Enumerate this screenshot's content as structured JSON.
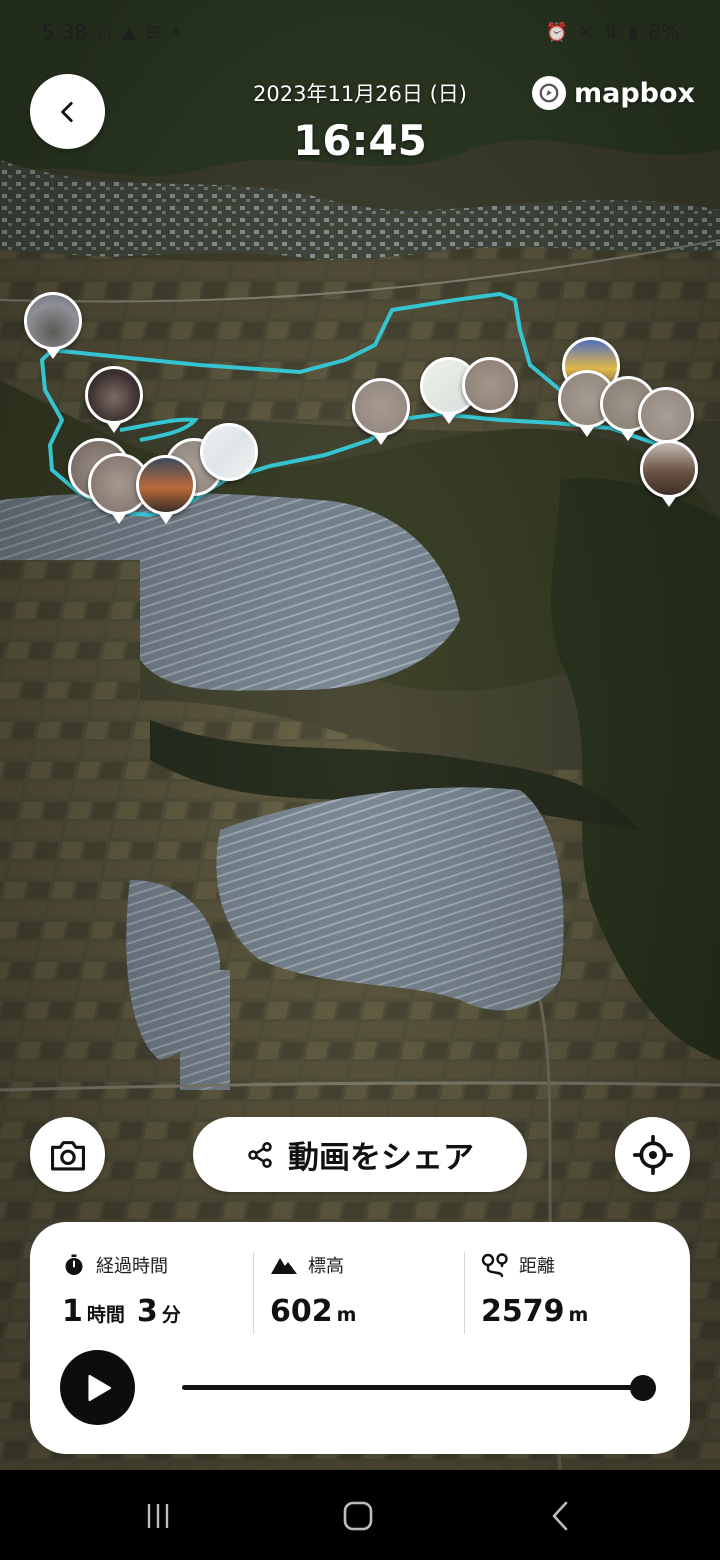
{
  "status_bar": {
    "time": "5:38",
    "left_icons": [
      "instagram-icon",
      "warning-icon",
      "grid-icon",
      "dot-icon"
    ],
    "right_icons": [
      "alarm-icon",
      "mute-icon",
      "4g-icon",
      "signal-icon"
    ],
    "battery": "8%"
  },
  "header": {
    "date": "2023年11月26日 (日)",
    "time": "16:45",
    "brand": "mapbox"
  },
  "colors": {
    "route": "#35c4d1",
    "card_bg": "#ffffff",
    "text_dark": "#111111"
  },
  "markers": [
    {
      "name": "photo-marker-1",
      "tone": "#6d6f78"
    },
    {
      "name": "photo-marker-2",
      "tone": "#3a3030"
    },
    {
      "name": "photo-marker-3",
      "tone": "#7c6f6a"
    },
    {
      "name": "photo-marker-4",
      "tone": "#8a7c74"
    },
    {
      "name": "photo-marker-5",
      "tone": "#b86a3a"
    },
    {
      "name": "photo-marker-6",
      "tone": "#948b83"
    },
    {
      "name": "photo-marker-map-1",
      "tone": "#e8ecef"
    },
    {
      "name": "photo-marker-7",
      "tone": "#968b82"
    },
    {
      "name": "photo-marker-map-2",
      "tone": "#e6ebe3"
    },
    {
      "name": "photo-marker-8",
      "tone": "#918579"
    },
    {
      "name": "photo-marker-9",
      "tone": "#4f6fbf"
    },
    {
      "name": "photo-marker-10",
      "tone": "#948a80"
    },
    {
      "name": "photo-marker-11",
      "tone": "#8e8379"
    },
    {
      "name": "photo-marker-12",
      "tone": "#988d84"
    },
    {
      "name": "photo-marker-13",
      "tone": "#6a5344"
    }
  ],
  "actions": {
    "camera_icon": "camera-icon",
    "share_label": "動画をシェア",
    "share_icon": "share-icon",
    "locate_icon": "crosshair-icon"
  },
  "stats": {
    "elapsed": {
      "label": "経過時間",
      "hours": "1",
      "hours_unit": "時間",
      "minutes": "3",
      "minutes_unit": "分",
      "icon": "stopwatch-icon"
    },
    "elevation": {
      "label": "標高",
      "value": "602",
      "unit": "m",
      "icon": "mountain-icon"
    },
    "distance": {
      "label": "距離",
      "value": "2579",
      "unit": "m",
      "icon": "route-pin-icon"
    }
  },
  "playback": {
    "icon": "play-icon",
    "progress": 1.0
  },
  "nav": {
    "items": [
      "recent-apps-icon",
      "home-icon",
      "back-nav-icon"
    ]
  }
}
